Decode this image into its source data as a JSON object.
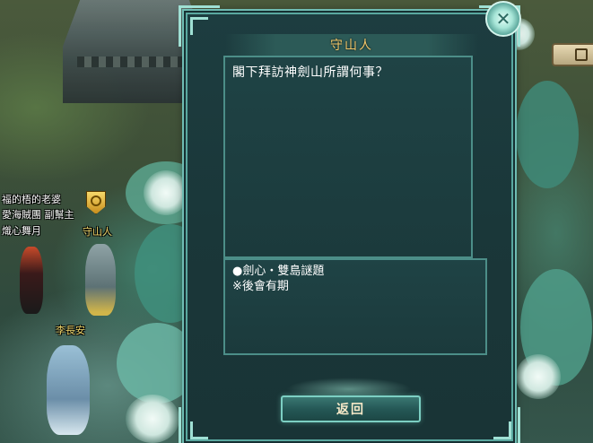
{
  "dialog": {
    "title": "守山人",
    "npc_text": "閣下拜訪神劍山所謂何事？",
    "options": [
      "●劍心・雙島謎題",
      "※後會有期"
    ],
    "back_label": "返回"
  },
  "scene": {
    "labels": [
      "福的梧的老婆",
      "愛海賊團 副幫主",
      "熾心舞月",
      "守山人",
      "李長安"
    ]
  },
  "colors": {
    "title": "#f2c86b",
    "dialog_bg": "#1b3a3c",
    "frame": "#9fe0d4",
    "npc_label": "#f0d66b"
  },
  "icons": [
    "close-icon",
    "quest-marker-icon",
    "side-panel-icon"
  ]
}
